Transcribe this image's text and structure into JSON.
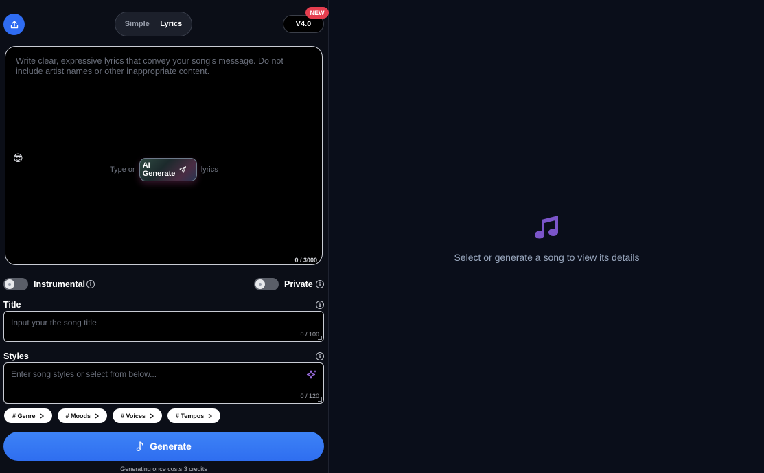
{
  "header": {
    "mode_simple": "Simple",
    "mode_lyrics": "Lyrics",
    "version": "V4.0",
    "new_badge": "NEW"
  },
  "lyrics": {
    "placeholder": "Write clear, expressive lyrics that convey your song's message. Do not include artist names or other inappropriate content.",
    "emoji": "😎",
    "type_or": "Type or",
    "ai_generate": "AI Generate",
    "lyrics_word": "lyrics",
    "count": "0 / 3000"
  },
  "options": {
    "instrumental_label": "Instrumental",
    "private_label": "Private"
  },
  "title_field": {
    "label": "Title",
    "placeholder": "Input your the song title",
    "count": "0 / 100"
  },
  "styles_field": {
    "label": "Styles",
    "placeholder": "Enter song styles or select from below...",
    "count": "0 / 120"
  },
  "tags": [
    "# Genre",
    "# Moods",
    "# Voices",
    "# Tempos"
  ],
  "generate": {
    "label": "Generate",
    "note": "Generating once costs 3 credits"
  },
  "empty_state": {
    "icon": "music-note-icon",
    "text": "Select or generate a song to view its details"
  },
  "colors": {
    "accent_blue": "#2f6ef0",
    "music_purple": "#7b55c9",
    "badge_red": "#e53e4f"
  }
}
